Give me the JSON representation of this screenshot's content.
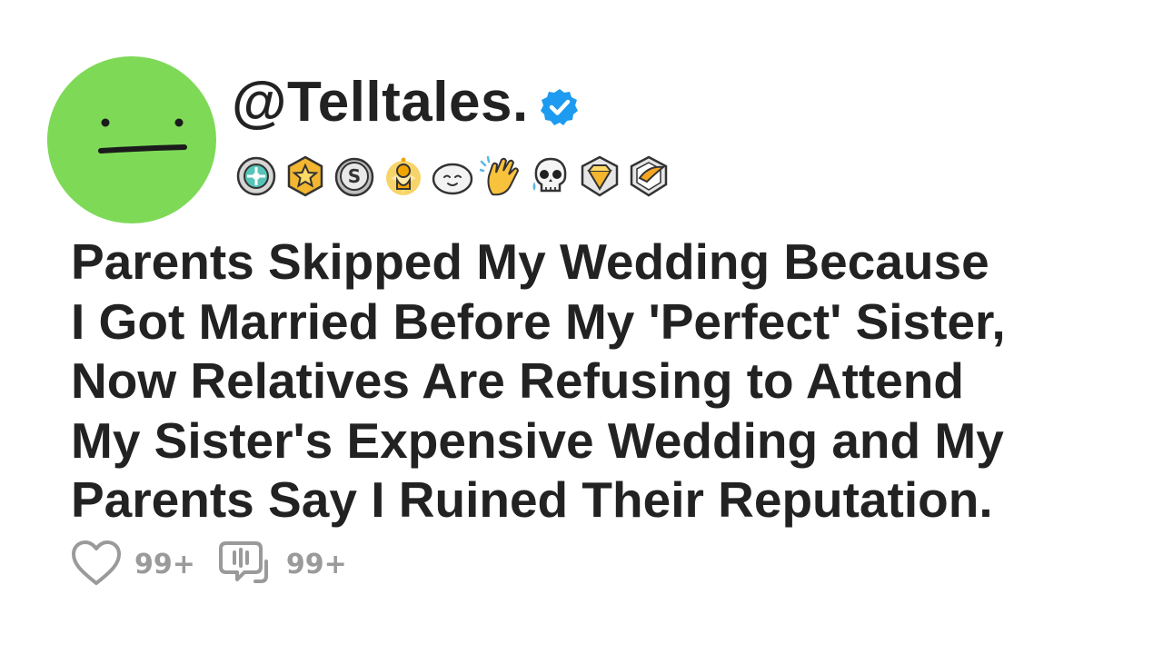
{
  "post": {
    "username": "@Telltales.",
    "verified": true,
    "avatar_color": "#7ed957",
    "title_lines": [
      "Parents Skipped My Wedding Because",
      "I Got Married Before My 'Perfect' Sister,",
      "Now Relatives Are Refusing to Attend",
      "My Sister's Expensive Wedding and My",
      "Parents Say I Ruined Their Reputation."
    ],
    "likes": "99+",
    "comments": "99+"
  },
  "badges": [
    "helpful-award-icon",
    "star-award-icon",
    "silver-award-icon",
    "gold-award-icon",
    "wholesome-seal-icon",
    "clapping-hands-icon",
    "crying-skull-icon",
    "diamond-award-icon",
    "platinum-award-icon"
  ],
  "colors": {
    "text": "#222222",
    "muted": "#9a9a9a",
    "verified_blue": "#1d9bf0"
  }
}
